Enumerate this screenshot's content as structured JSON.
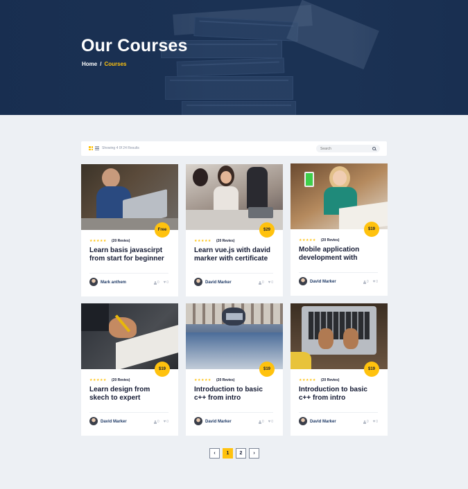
{
  "hero": {
    "title": "Our Courses",
    "breadcrumb": {
      "home": "Home",
      "separator": "/",
      "current": "Courses"
    }
  },
  "toolbar": {
    "showing_text": "Showing 4 0f 24 Results",
    "search_placeholder": "Search",
    "icons": [
      "grid-view-icon",
      "list-view-icon",
      "search-icon"
    ]
  },
  "colors": {
    "accent": "#ffc20e",
    "hero_bg": "#1f3658",
    "author": "#1f3a66",
    "page_bg": "#edf0f4"
  },
  "courses": [
    {
      "price": "Free",
      "stars": "★★★★★",
      "reviews": "(20 Revies)",
      "title": "Learn basis javascirpt from start for beginner",
      "author": "Mark anthem",
      "students": "0",
      "likes": "0"
    },
    {
      "price": "$29",
      "stars": "★★★★★",
      "reviews": "(20 Revies)",
      "title": "Learn vue.js with david marker with certificate",
      "author": "David Marker",
      "students": "0",
      "likes": "0"
    },
    {
      "price": "$19",
      "stars": "★★★★★",
      "reviews": "(20 Revies)",
      "title": "Mobile application development with",
      "author": "David Marker",
      "students": "0",
      "likes": "0"
    },
    {
      "price": "$19",
      "stars": "★★★★★",
      "reviews": "(20 Revies)",
      "title": "Learn design from skech to expert",
      "author": "David Marker",
      "students": "0",
      "likes": "0"
    },
    {
      "price": "$19",
      "stars": "★★★★★",
      "reviews": "(20 Revies)",
      "title": "Introduction to basic c++ from intro",
      "author": "David Marker",
      "students": "0",
      "likes": "0"
    },
    {
      "price": "$19",
      "stars": "★★★★★",
      "reviews": "(20 Revies)",
      "title": "Introduction to basic c++ from intro",
      "author": "David Marker",
      "students": "0",
      "likes": "0"
    }
  ],
  "pagination": {
    "prev": "‹",
    "pages": [
      "1",
      "2"
    ],
    "next": "›",
    "active": "1"
  }
}
